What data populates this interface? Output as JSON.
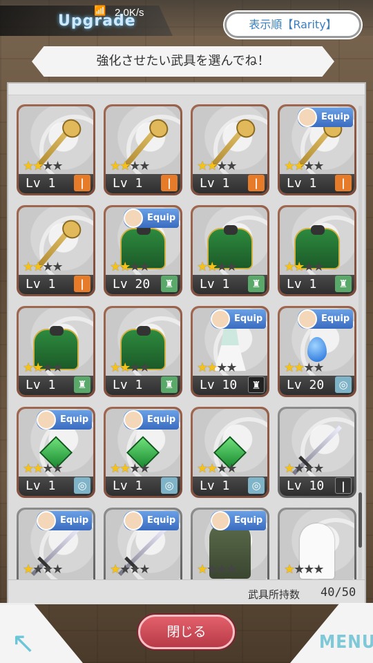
{
  "header": {
    "title": "Upgrade",
    "speed": "2.0K/s",
    "sort_label": "表示順【Rarity】"
  },
  "banner": "強化させたい武具を選んでね！",
  "footer": {
    "count_label": "武具所持数",
    "count": "40/50"
  },
  "buttons": {
    "close": "閉じる",
    "menu": "MENU"
  },
  "equip_label": "Equip",
  "cards": [
    {
      "item": "staff",
      "stars": 2,
      "lv": "Lv 1",
      "type": "staff",
      "equip": false,
      "frame": "bronze"
    },
    {
      "item": "staff",
      "stars": 2,
      "lv": "Lv 1",
      "type": "staff",
      "equip": false,
      "frame": "bronze"
    },
    {
      "item": "staff",
      "stars": 2,
      "lv": "Lv 1",
      "type": "staff",
      "equip": false,
      "frame": "bronze"
    },
    {
      "item": "staff",
      "stars": 2,
      "lv": "Lv 1",
      "type": "staff",
      "equip": true,
      "frame": "bronze"
    },
    {
      "item": "staff",
      "stars": 2,
      "lv": "Lv 1",
      "type": "staff",
      "equip": false,
      "frame": "bronze"
    },
    {
      "item": "armor",
      "stars": 2,
      "lv": "Lv 20",
      "type": "armor",
      "equip": true,
      "frame": "bronze"
    },
    {
      "item": "armor",
      "stars": 2,
      "lv": "Lv 1",
      "type": "armor",
      "equip": false,
      "frame": "bronze"
    },
    {
      "item": "armor",
      "stars": 2,
      "lv": "Lv 1",
      "type": "armor",
      "equip": false,
      "frame": "bronze"
    },
    {
      "item": "armor",
      "stars": 2,
      "lv": "Lv 1",
      "type": "armor",
      "equip": false,
      "frame": "bronze"
    },
    {
      "item": "armor",
      "stars": 2,
      "lv": "Lv 1",
      "type": "armor",
      "equip": false,
      "frame": "bronze"
    },
    {
      "item": "dress",
      "stars": 2,
      "lv": "Lv 10",
      "type": "armor2",
      "equip": true,
      "frame": "bronze"
    },
    {
      "item": "pendant",
      "stars": 2,
      "lv": "Lv 20",
      "type": "neck",
      "equip": true,
      "frame": "bronze"
    },
    {
      "item": "gem",
      "stars": 2,
      "lv": "Lv 1",
      "type": "neck",
      "equip": true,
      "frame": "bronze"
    },
    {
      "item": "gem",
      "stars": 2,
      "lv": "Lv 1",
      "type": "neck",
      "equip": true,
      "frame": "bronze"
    },
    {
      "item": "gem",
      "stars": 2,
      "lv": "Lv 1",
      "type": "neck",
      "equip": false,
      "frame": "bronze"
    },
    {
      "item": "sword",
      "stars": 1,
      "lv": "Lv 10",
      "type": "sword",
      "equip": false,
      "frame": "silver"
    },
    {
      "item": "sword",
      "stars": 1,
      "lv": "",
      "type": "",
      "equip": true,
      "frame": "silver"
    },
    {
      "item": "sword",
      "stars": 1,
      "lv": "",
      "type": "",
      "equip": true,
      "frame": "silver"
    },
    {
      "item": "knight",
      "stars": 1,
      "lv": "",
      "type": "",
      "equip": true,
      "frame": "silver"
    },
    {
      "item": "cloak",
      "stars": 1,
      "lv": "",
      "type": "",
      "equip": false,
      "frame": "silver"
    }
  ]
}
